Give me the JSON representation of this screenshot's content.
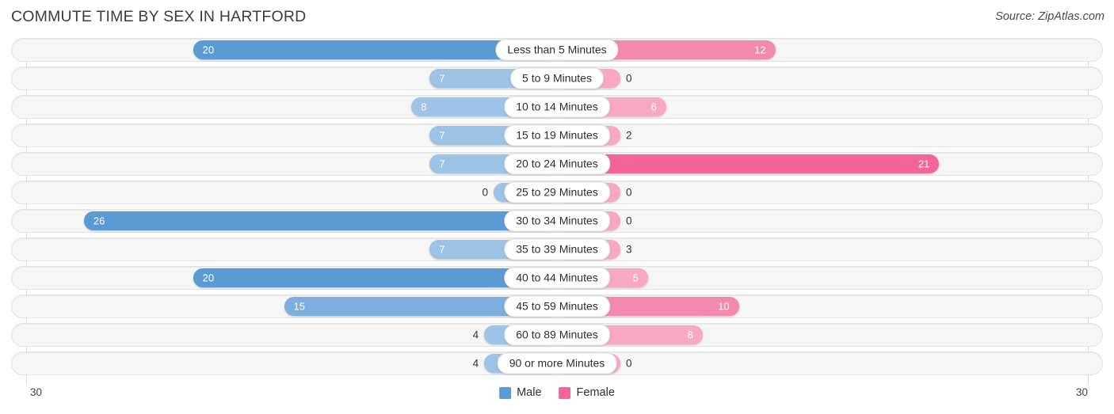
{
  "header": {
    "title": "COMMUTE TIME BY SEX IN HARTFORD",
    "source": "Source: ZipAtlas.com"
  },
  "axis": {
    "left_end_label": "30",
    "right_end_label": "30",
    "max": 30
  },
  "legend": {
    "position": "bottom-center",
    "items": [
      {
        "label": "Male",
        "color": "#5b9bd5"
      },
      {
        "label": "Female",
        "color": "#f2649a"
      }
    ]
  },
  "colors": {
    "male_light": "#9dc3e6",
    "male_mid": "#7eaedd",
    "male_strong": "#5b9bd5",
    "female_light": "#f9a8c4",
    "female_mid": "#f489b0",
    "female_strong": "#f2649a",
    "track": "#f6f6f6",
    "gridline": "#d7d7d7"
  },
  "chart_data": {
    "type": "bar",
    "subtype": "diverging-bidirectional-bar",
    "title": "COMMUTE TIME BY SEX IN HARTFORD",
    "xlabel": "",
    "ylabel": "",
    "xlim": [
      30,
      30
    ],
    "grid": true,
    "categories": [
      "Less than 5 Minutes",
      "5 to 9 Minutes",
      "10 to 14 Minutes",
      "15 to 19 Minutes",
      "20 to 24 Minutes",
      "25 to 29 Minutes",
      "30 to 34 Minutes",
      "35 to 39 Minutes",
      "40 to 44 Minutes",
      "45 to 59 Minutes",
      "60 to 89 Minutes",
      "90 or more Minutes"
    ],
    "series": [
      {
        "name": "Male",
        "color": "#5b9bd5",
        "direction": "left",
        "values": [
          20,
          7,
          8,
          7,
          7,
          0,
          26,
          7,
          20,
          15,
          4,
          4
        ]
      },
      {
        "name": "Female",
        "color": "#f2649a",
        "direction": "right",
        "values": [
          12,
          0,
          6,
          2,
          21,
          0,
          0,
          3,
          5,
          10,
          8,
          0
        ]
      }
    ]
  },
  "rows": [
    {
      "label": "Less than 5 Minutes",
      "male": "20",
      "female": "12"
    },
    {
      "label": "5 to 9 Minutes",
      "male": "7",
      "female": "0"
    },
    {
      "label": "10 to 14 Minutes",
      "male": "8",
      "female": "6"
    },
    {
      "label": "15 to 19 Minutes",
      "male": "7",
      "female": "2"
    },
    {
      "label": "20 to 24 Minutes",
      "male": "7",
      "female": "21"
    },
    {
      "label": "25 to 29 Minutes",
      "male": "0",
      "female": "0"
    },
    {
      "label": "30 to 34 Minutes",
      "male": "26",
      "female": "0"
    },
    {
      "label": "35 to 39 Minutes",
      "male": "7",
      "female": "3"
    },
    {
      "label": "40 to 44 Minutes",
      "male": "20",
      "female": "5"
    },
    {
      "label": "45 to 59 Minutes",
      "male": "15",
      "female": "10"
    },
    {
      "label": "60 to 89 Minutes",
      "male": "4",
      "female": "8"
    },
    {
      "label": "90 or more Minutes",
      "male": "4",
      "female": "0"
    }
  ]
}
